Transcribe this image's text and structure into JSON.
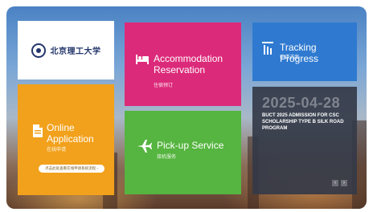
{
  "logo": {
    "name": "北京理工大学"
  },
  "tiles": {
    "accommodation": {
      "title": "Accommodation Reservation",
      "subtitle": "住宿预订",
      "icon": "bed-icon",
      "color": "#dc2a7a"
    },
    "tracking": {
      "title": "Tracking Progress",
      "subtitle": "申请进度",
      "icon": "progress-icon",
      "color": "#2f7ad0"
    },
    "online_application": {
      "title": "Online Application",
      "subtitle": "在线申请",
      "button": "点击此处查看在线申请系统流程 ›",
      "icon": "document-icon",
      "color": "#f2a11c"
    },
    "pickup": {
      "title": "Pick-up Service",
      "subtitle": "接机服务",
      "icon": "airplane-icon",
      "color": "#56b540"
    }
  },
  "news": {
    "date": "2025-04-28",
    "headline": "BUCT 2025 ADMISSION FOR CSC SCHOLARSHIP TYPE B SILK ROAD PROGRAM",
    "prev": "‹",
    "next": "›"
  }
}
